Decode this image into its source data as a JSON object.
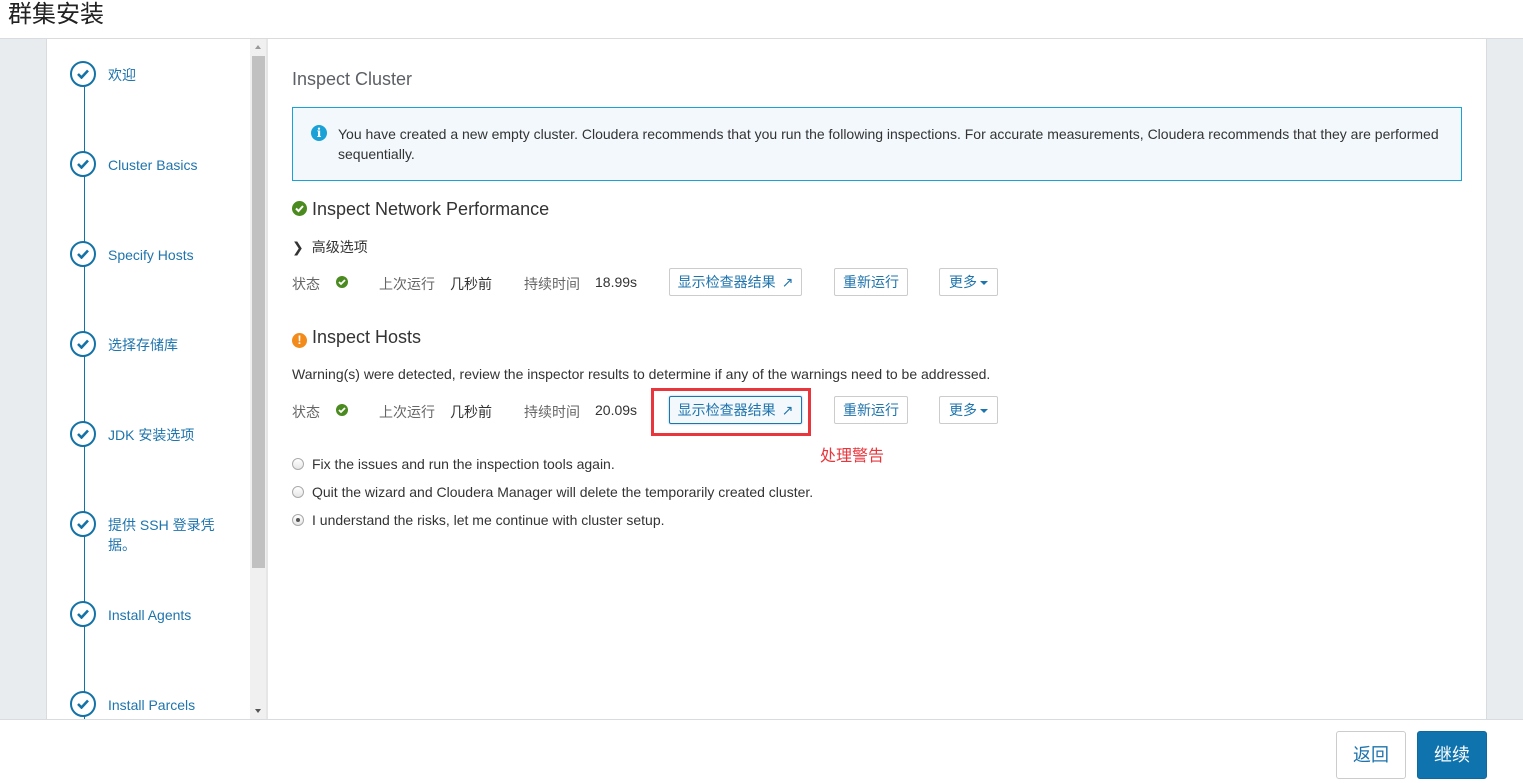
{
  "header": {
    "title": "群集安装"
  },
  "sidebar": {
    "steps": [
      {
        "label": "欢迎",
        "status": "complete"
      },
      {
        "label": "Cluster Basics",
        "status": "complete"
      },
      {
        "label": "Specify Hosts",
        "status": "complete"
      },
      {
        "label": "选择存储库",
        "status": "complete"
      },
      {
        "label": "JDK 安装选项",
        "status": "complete"
      },
      {
        "label": "提供 SSH 登录凭据。",
        "status": "complete"
      },
      {
        "label": "Install Agents",
        "status": "complete"
      },
      {
        "label": "Install Parcels",
        "status": "complete"
      }
    ]
  },
  "main": {
    "title": "Inspect Cluster",
    "info_message": "You have created a new empty cluster. Cloudera recommends that you run the following inspections. For accurate measurements, Cloudera recommends that they are performed sequentially.",
    "network": {
      "title": "Inspect Network Performance",
      "status_icon": "check-circle-icon",
      "advanced_label": "高级选项",
      "status_label": "状态",
      "last_run_label": "上次运行",
      "last_run_value": "几秒前",
      "duration_label": "持续时间",
      "duration_value": "18.99s",
      "show_results_label": "显示检查器结果",
      "rerun_label": "重新运行",
      "more_label": "更多"
    },
    "hosts": {
      "title": "Inspect Hosts",
      "status_icon": "warning-circle-icon",
      "warning_text": "Warning(s) were detected, review the inspector results to determine if any of the warnings need to be addressed.",
      "status_label": "状态",
      "last_run_label": "上次运行",
      "last_run_value": "几秒前",
      "duration_label": "持续时间",
      "duration_value": "20.09s",
      "show_results_label": "显示检查器结果",
      "rerun_label": "重新运行",
      "more_label": "更多",
      "annotation": "处理警告"
    },
    "options": [
      {
        "label": "Fix the issues and run the inspection tools again.",
        "selected": false
      },
      {
        "label": "Quit the wizard and Cloudera Manager will delete the temporarily created cluster.",
        "selected": false
      },
      {
        "label": "I understand the risks, let me continue with cluster setup.",
        "selected": true
      }
    ]
  },
  "footer": {
    "back_label": "返回",
    "continue_label": "继续"
  },
  "colors": {
    "accent": "#1e74ad",
    "primary_button": "#0f73ad",
    "ok": "#4a8a1f",
    "warning": "#f28b1a",
    "annotation": "#e8363c",
    "info_border": "#1aa1d6"
  }
}
